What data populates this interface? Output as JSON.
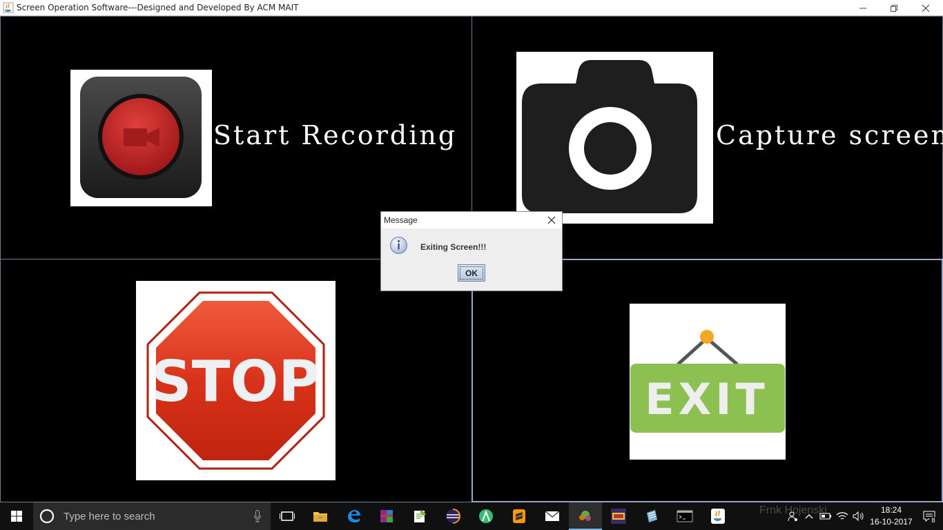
{
  "window": {
    "title": "Screen Operation Software---Designed and Developed By ACM MAIT",
    "min_glyph": "—",
    "max_glyph": "❐",
    "close_glyph": "✕"
  },
  "panels": {
    "record": {
      "label": "Start Recording",
      "icon": "record-button-icon"
    },
    "capture": {
      "label": "Capture screen",
      "icon": "camera-icon"
    },
    "stop": {
      "text": "STOP",
      "icon": "stop-sign-icon"
    },
    "exit": {
      "text": "EXIT",
      "icon": "exit-sign-icon"
    }
  },
  "dialog": {
    "title": "Message",
    "message": "Exiting Screen!!!",
    "ok_label": "OK",
    "icon": "info-icon"
  },
  "taskbar": {
    "search_placeholder": "Type here to search",
    "ghost_text": "Frnk Hojenski",
    "time": "18:24",
    "date": "16-10-2017",
    "notification_count": "8",
    "apps": [
      "task-view",
      "file-explorer",
      "edge",
      "winrar",
      "notepad-plus",
      "eclipse",
      "android-studio",
      "sublime-text",
      "mail",
      "java-app",
      "game",
      "notepad",
      "cmd",
      "java"
    ]
  },
  "colors": {
    "record_red": "#c4222b",
    "stop_red": "#d8331a",
    "exit_green": "#8cc152",
    "exit_pin": "#f5a623",
    "camera_dark": "#1e1e1e"
  }
}
